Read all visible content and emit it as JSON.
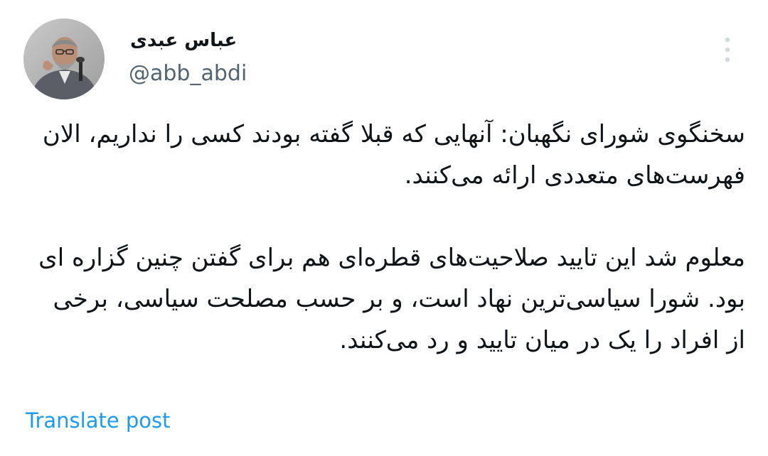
{
  "author": {
    "display_name": "عباس عبدی",
    "handle": "@abb_abdi",
    "avatar_icon": "profile-photo"
  },
  "tweet": {
    "paragraphs": [
      "سخنگوی شورای نگهبان: آنهایی که قبلا گفته بودند کسی را نداریم، الان فهرست‌های متعددی ارائه می‌کنند.",
      "معلوم شد این تایید صلاحیت‌های قطره‌ای هم برای گفتن چنین گزاره ای بود. شورا سیاسی‌ترین نهاد است، و بر حسب مصلحت سیاسی، برخی از افراد را یک در میان تایید و رد می‌کنند."
    ]
  },
  "actions": {
    "translate_label": "Translate post",
    "more_icon": "more-vertical-icon"
  },
  "colors": {
    "text": "#0f1419",
    "secondary_text": "#536471",
    "link": "#1d9bf0",
    "more_icon": "#cfd9de"
  }
}
